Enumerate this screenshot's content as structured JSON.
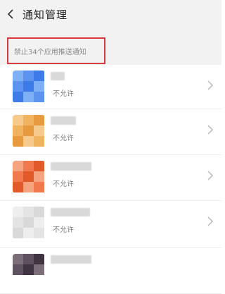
{
  "header": {
    "title": "通知管理"
  },
  "notice": {
    "text": "禁止34个应用推送通知"
  },
  "apps": [
    {
      "status": "不允许",
      "icon_colors": [
        "#7fb0f5",
        "#5b93ef",
        "#3d7ce8"
      ]
    },
    {
      "status": "不允许",
      "icon_colors": [
        "#f6c98c",
        "#f0b35f",
        "#e89a3e"
      ]
    },
    {
      "status": "不允许",
      "icon_colors": [
        "#f6a37f",
        "#f07a4d",
        "#e25a2a"
      ]
    },
    {
      "status": "不允许",
      "icon_colors": [
        "#eeeeee",
        "#e4e4e4",
        "#d9d9d9"
      ]
    },
    {
      "status": "",
      "icon_colors": [
        "#7b6e78",
        "#5e5160",
        "#3f3440"
      ]
    }
  ]
}
